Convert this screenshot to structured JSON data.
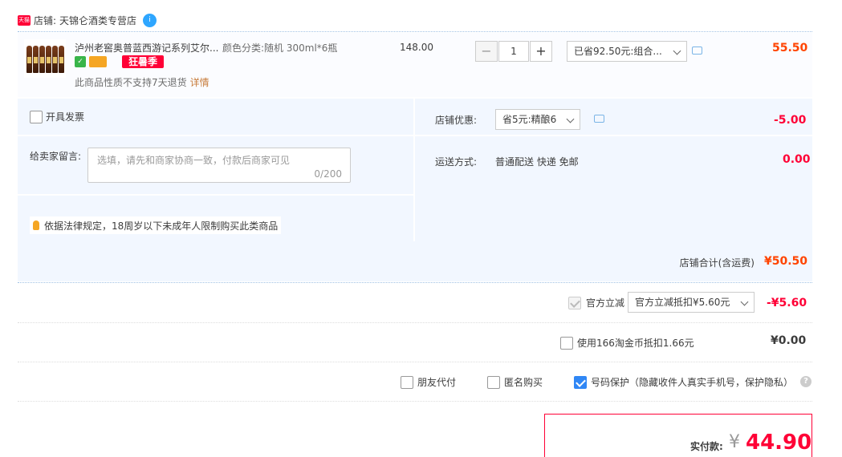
{
  "store": {
    "badge": "天猫",
    "prefix": "店铺:",
    "name": "天锦仑酒类专营店",
    "chat_icon": "wangwang-icon"
  },
  "item": {
    "title": "泸州老窖奥普蓝西游记系列艾尔...",
    "sku": "颜色分类:随机 300ml*6瓶",
    "promo_tag": "狂暑季",
    "return_note": "此商品性质不支持7天退货",
    "detail_link": "详情",
    "unit_price": "148.00",
    "quantity": "1",
    "qty_minus": "−",
    "qty_plus": "+",
    "discount_select": "已省92.50元:组合...",
    "total": "55.50"
  },
  "options": {
    "invoice_label": "开具发票",
    "message_label": "给卖家留言:",
    "message_placeholder": "选填，请先和商家协商一致，付款后商家可见",
    "message_count": "0/200",
    "law_note": "依据法律规定，18周岁以下未成年人限制购买此类商品",
    "shop_discount_label": "店铺优惠:",
    "shop_discount_select": "省5元:精酿6",
    "shop_discount_amount": "-5.00",
    "shipping_label": "运送方式:",
    "shipping_value": "普通配送 快递 免邮",
    "shipping_amount": "0.00"
  },
  "shop_total": {
    "label": "店铺合计(含运费)",
    "value": "¥50.50"
  },
  "official": {
    "label": "官方立减",
    "select": "官方立减抵扣¥5.60元",
    "amount": "-¥5.60"
  },
  "coins": {
    "label": "使用166淘金币抵扣1.66元",
    "amount": "¥0.00"
  },
  "extras": {
    "friend_pay": "朋友代付",
    "anonymous": "匿名购买",
    "number_protect": "号码保护（隐藏收件人真实手机号，保护隐私）"
  },
  "payment": {
    "label": "实付款:",
    "yen": "¥",
    "amount": "44.90"
  },
  "colors": {
    "accent_red": "#ff0036",
    "orange_price": "#ff4400",
    "panel_bg": "#f2f7ff",
    "checkbox_blue": "#3087f5"
  }
}
